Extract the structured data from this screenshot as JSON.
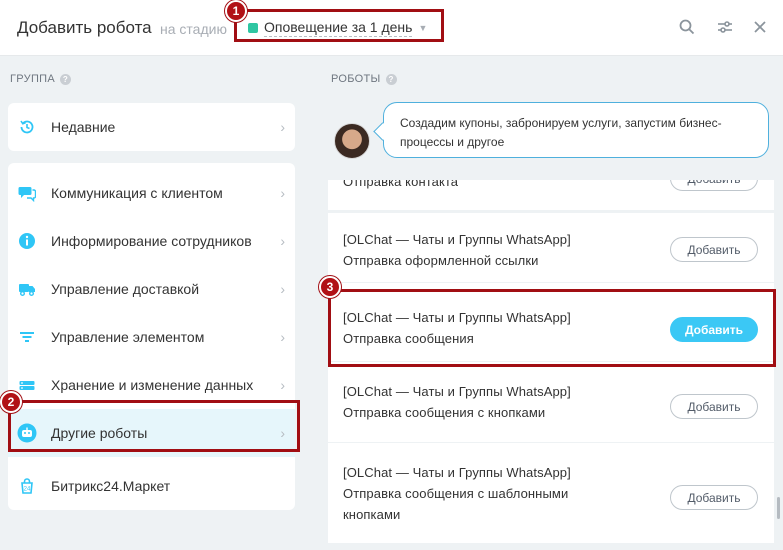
{
  "header": {
    "title": "Добавить робота",
    "stage_label": "на стадию",
    "stage_value": "Оповещение за 1 день",
    "stage_color": "#2fc6a2"
  },
  "left": {
    "section_title": "ГРУППА",
    "recent": {
      "label": "Недавние",
      "icon": "history-icon"
    },
    "items": [
      {
        "label": "Коммуникация с клиентом",
        "icon": "chat-icon"
      },
      {
        "label": "Информирование сотрудников",
        "icon": "info-icon"
      },
      {
        "label": "Управление доставкой",
        "icon": "truck-icon"
      },
      {
        "label": "Управление элементом",
        "icon": "filter-icon"
      },
      {
        "label": "Хранение и изменение данных",
        "icon": "database-icon"
      },
      {
        "label": "Другие роботы",
        "icon": "robot-icon",
        "active": true
      }
    ],
    "market": {
      "label": "Битрикс24.Маркет",
      "icon": "market-icon"
    }
  },
  "right": {
    "section_title": "РОБОТЫ",
    "hint": "Создадим купоны, забронируем услуги, запустим бизнес-процессы и другое",
    "robots": [
      {
        "line1": "Отправка контакта",
        "button": "Добавить"
      },
      {
        "line1": "[OLChat — Чаты и Группы WhatsApp]",
        "line2": "Отправка оформленной ссылки",
        "button": "Добавить"
      },
      {
        "line1": "[OLChat — Чаты и Группы WhatsApp]",
        "line2": "Отправка сообщения",
        "button": "Добавить"
      },
      {
        "line1": "[OLChat — Чаты и Группы WhatsApp]",
        "line2": "Отправка сообщения с кнопками",
        "button": "Добавить"
      },
      {
        "line1": "[OLChat — Чаты и Группы WhatsApp]",
        "line2": "Отправка сообщения с шаблонными",
        "line3": "кнопками",
        "button": "Добавить"
      }
    ]
  },
  "callouts": [
    "1",
    "2",
    "3"
  ],
  "colors": {
    "accent": "#3bc8f5",
    "callout": "#a10e13",
    "active_bg": "#e6f6fb"
  }
}
